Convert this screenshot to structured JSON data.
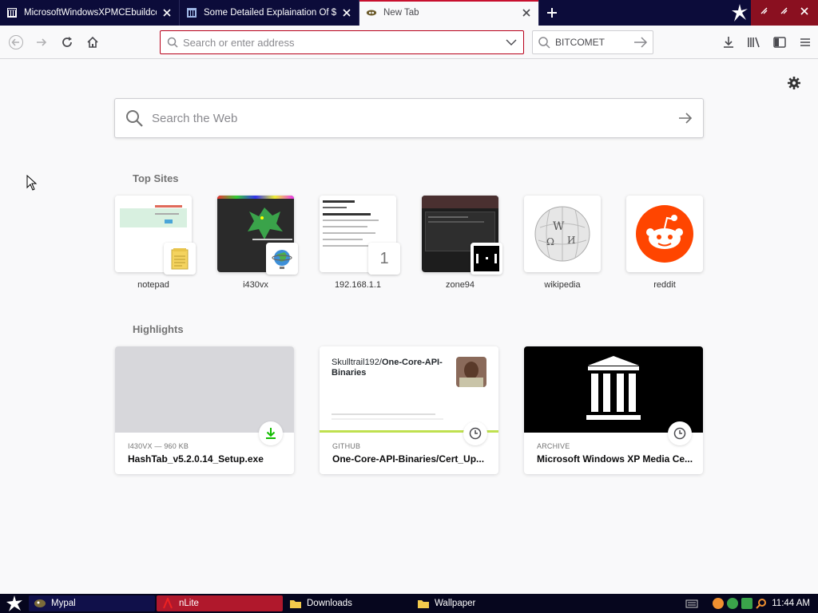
{
  "tabs": [
    {
      "title": "MicrosoftWindowsXPMCEbuildcolle",
      "favicon": "archive-icon"
    },
    {
      "title": "Some Detailed Explaination Of $OE",
      "favicon": "archive-icon"
    },
    {
      "title": "New Tab",
      "favicon": "firefox-icon"
    }
  ],
  "urlbar": {
    "placeholder": "Search or enter address"
  },
  "searchbar": {
    "text": "BITCOMET"
  },
  "websearch": {
    "placeholder": "Search the Web"
  },
  "sections": {
    "top_sites": "Top Sites",
    "highlights": "Highlights"
  },
  "top_sites": [
    {
      "label": "notepad"
    },
    {
      "label": "i430vx"
    },
    {
      "label": "192.168.1.1",
      "badge": "1"
    },
    {
      "label": "zone94"
    },
    {
      "label": "wikipedia"
    },
    {
      "label": "reddit"
    }
  ],
  "highlights": [
    {
      "context": "I430VX — 960 KB",
      "title": "HashTab_v5.2.0.14_Setup.exe",
      "icon": "download-icon"
    },
    {
      "context": "GITHUB",
      "title": "One-Core-API-Binaries/Cert_Up...",
      "preview_owner": "Skulltrail192/",
      "preview_repo": "One-Core-API-Binaries",
      "icon": "clock-icon"
    },
    {
      "context": "ARCHIVE",
      "title": "Microsoft Windows XP Media Ce...",
      "icon": "clock-icon"
    }
  ],
  "taskbar": {
    "items": [
      {
        "label": "Mypal"
      },
      {
        "label": "nLite"
      },
      {
        "label": "Downloads"
      },
      {
        "label": "Wallpaper"
      }
    ],
    "clock": "11:44 AM"
  },
  "colors": {
    "accent": "#c8102e",
    "tabstrip": "#0c0c3a",
    "reddit": "#ff4500"
  }
}
